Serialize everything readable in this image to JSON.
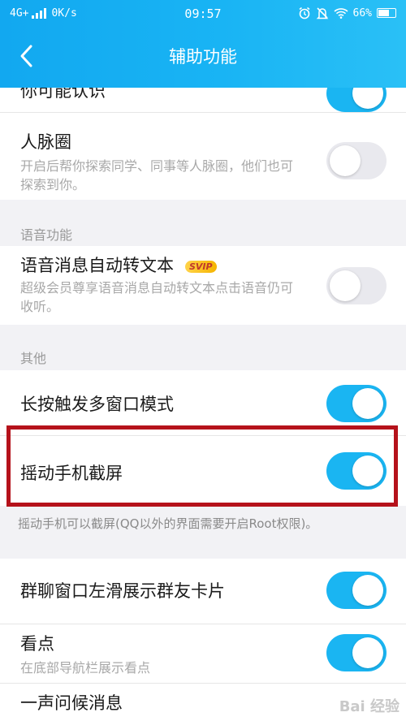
{
  "status_bar": {
    "network": "4G+",
    "speed": "0K/s",
    "time": "09:57",
    "battery": "66%"
  },
  "header": {
    "title": "辅助功能"
  },
  "settings": {
    "partial_top": {
      "title": "你可能认识",
      "enabled": true
    },
    "renmaiquan": {
      "title": "人脉圈",
      "desc": "开启后帮你探索同学、同事等人脉圈，他们也可探索到你。",
      "enabled": false
    },
    "voice_section": {
      "label": "语音功能"
    },
    "voice_to_text": {
      "title": "语音消息自动转文本",
      "badge": "SVIP",
      "desc": "超级会员尊享语音消息自动转文本点击语音仍可收听。",
      "enabled": false
    },
    "other_section": {
      "label": "其他"
    },
    "multi_window": {
      "title": "长按触发多窗口模式",
      "enabled": true
    },
    "shake_screenshot": {
      "title": "摇动手机截屏",
      "enabled": true,
      "note": "摇动手机可以截屏(QQ以外的界面需要开启Root权限)。"
    },
    "group_card": {
      "title": "群聊窗口左滑展示群友卡片",
      "enabled": true
    },
    "kandian": {
      "title": "看点",
      "desc": "在底部导航栏展示看点",
      "enabled": true
    },
    "greeting": {
      "title": "一声问候消息"
    }
  },
  "watermark": "Bai 经验"
}
